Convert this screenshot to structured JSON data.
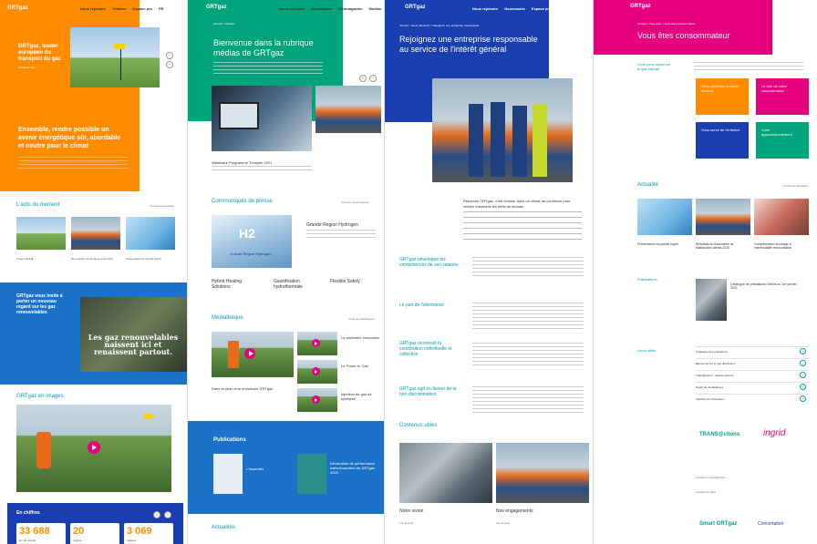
{
  "p1": {
    "logo": "GRTgaz",
    "nav": [
      "Nous rejoindre",
      "Tenders",
      "Espace pro",
      "FR"
    ],
    "hero_title": "GRTgaz, leader européen du transport du gaz",
    "hero_sub": "En savoir plus",
    "mission": "Ensemble, rendre possible un avenir énergétique sûr, abordable et neutre pour le climat",
    "actu_title": "L'actu du moment",
    "actu_more": "Toutes les actualités",
    "actu_items": [
      "Projet JUCHE",
      "Nos métiers techniques au féminin",
      "Présentation du portail Ingrid"
    ],
    "promo_title": "GRTgaz vous invite à porter un nouveau regard sur les gaz renouvelables",
    "promo_overlay": "Les gaz renouvelables naissent ici et renaissent partout.",
    "images_title": "GRTgaz en images",
    "chiffres_title": "En chiffres",
    "stats": [
      {
        "value": "33 688",
        "label": "km de réseau"
      },
      {
        "value": "20",
        "label": "régions"
      },
      {
        "value": "3 069",
        "label": "salariés"
      }
    ]
  },
  "p2": {
    "logo": "GRTgaz",
    "nav": [
      "Nous rejoindre",
      "Nouveautés",
      "Webmagazine",
      "Médias"
    ],
    "breadcrumb": "Accueil  >  Médias",
    "title": "Bienvenue dans la rubrique médias de GRTgaz",
    "event_caption": "Webinaire Programme Tremplin 2021",
    "press_title": "Communiqués de presse",
    "press_more": "Tous les communiqués",
    "press_items": [
      "Grande Region Hydrogen",
      "Hybrid Heating Solutions",
      "Gazéification hydrothermale",
      "Flexible Safety"
    ],
    "h2_label": "H2",
    "h2_sub": "Grande Région Hydrogen",
    "media_title": "Médiathèque",
    "media_more": "Toute la médiathèque",
    "media_caption": "Dans la peau d'un technicien GRTgaz",
    "media_items": [
      "Le webinaire innovation",
      "Le Power to Gas",
      "Injection de gaz de synthèse"
    ],
    "pub_title": "Publications",
    "pub_items": [
      "L'essentiel",
      "Déclaration de performance extra-financière de GRTgaz 2020"
    ],
    "actus_title": "Actualités"
  },
  "p3": {
    "logo": "GRTgaz",
    "nav": [
      "Nous rejoindre",
      "Nouveautés",
      "Espace presse",
      "Médias"
    ],
    "breadcrumb": "Accueil  >  Nous découvrir  >  Rejoignez une entreprise responsable",
    "title": "Rejoignez une entreprise responsable au service de l'intérêt général",
    "intro": "Rejoindre GRTgaz, c'est évoluer dans un climat de confiance pour relever ensemble les défis de demain",
    "sections": [
      "GRTgaz développe les compétences de ses salariés",
      "Le pari de l'alternance",
      "GRTgaz reconnaît la contribution individuelle et collective",
      "GRTgaz agit en faveur de la non-discrimination"
    ],
    "useful_title": "Contenus utiles",
    "useful_items": [
      "Notre vision",
      "Nos engagements"
    ],
    "useful_more": "Lire la suite"
  },
  "p4": {
    "logo": "GRTgaz",
    "breadcrumb": "Accueil  >  Vous êtes  >  Vous êtes consommateur",
    "title": "Vous êtes consommateur",
    "lead": "Vous vous situez sur le gaz naturel",
    "tiles": [
      {
        "label": "Vous cherchez à entrer Maison",
        "color": "#ff8c00"
      },
      {
        "label": "Le rôle de votre raccordement",
        "color": "#e5007e"
      },
      {
        "label": "Vous serez de l'enfance",
        "color": "#1a3fb0"
      },
      {
        "label": "Votre approvisionnement",
        "color": "#00a47a"
      }
    ],
    "actu_title": "Actualité",
    "actu_more": "Toutes les actualités",
    "actu_items": [
      "Présentation du portail Ingrid",
      "Résultats du Baromètre de satisfaction clients 2020",
      "Compensation stockage & intermodalité renouvelable"
    ],
    "pub_title": "Publications",
    "pub_item": "Catalogue de prestations Clients au 1er janvier 2021",
    "links_title": "Liens utiles",
    "links": [
      "Catalogue des prestations",
      "Bienvenue sur le gaz distributeur",
      "Trans@ctions : espace réservé",
      "Dépôt de candidatures",
      "Interface de réservation"
    ],
    "brands": [
      "TRANS@ctions",
      "ingrid",
      "Smart GRTgaz",
      "Concertation"
    ],
    "brand_links": [
      "Accéder à Trans@ctions",
      "Accéder à Ingrid"
    ]
  }
}
